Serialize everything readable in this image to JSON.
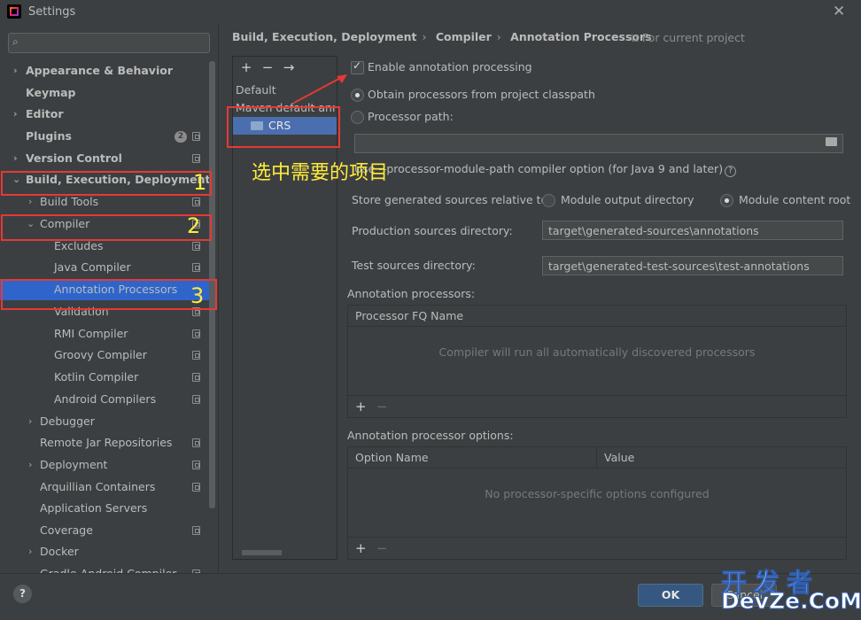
{
  "window": {
    "title": "Settings"
  },
  "search": {
    "placeholder": ""
  },
  "sidebar": {
    "items": [
      {
        "label": "Appearance & Behavior"
      },
      {
        "label": "Keymap"
      },
      {
        "label": "Editor"
      },
      {
        "label": "Plugins",
        "badge": "2"
      },
      {
        "label": "Version Control"
      },
      {
        "label": "Build, Execution, Deployment"
      },
      {
        "label": "Build Tools"
      },
      {
        "label": "Compiler"
      },
      {
        "label": "Excludes"
      },
      {
        "label": "Java Compiler"
      },
      {
        "label": "Annotation Processors"
      },
      {
        "label": "Validation"
      },
      {
        "label": "RMI Compiler"
      },
      {
        "label": "Groovy Compiler"
      },
      {
        "label": "Kotlin Compiler"
      },
      {
        "label": "Android Compilers"
      },
      {
        "label": "Debugger"
      },
      {
        "label": "Remote Jar Repositories"
      },
      {
        "label": "Deployment"
      },
      {
        "label": "Arquillian Containers"
      },
      {
        "label": "Application Servers"
      },
      {
        "label": "Coverage"
      },
      {
        "label": "Docker"
      },
      {
        "label": "Gradle-Android Compiler"
      }
    ]
  },
  "breadcrumb": {
    "items": [
      "Build, Execution, Deployment",
      "Compiler",
      "Annotation Processors"
    ],
    "scope": "For current project"
  },
  "profiles": {
    "toolbar": [
      "+",
      "−",
      "→"
    ],
    "items": [
      "Default",
      "Maven default anno",
      "CRS"
    ]
  },
  "options": {
    "enable_processing": "Enable annotation processing",
    "obtain_from_classpath": "Obtain processors from project classpath",
    "processor_path": "Processor path:",
    "module_path_option": "Use --processor-module-path compiler option (for Java 9 and later)",
    "store_generated_label": "Store generated sources relative to:",
    "module_output_dir": "Module output directory",
    "module_content_root": "Module content root",
    "production_dir_label": "Production sources directory:",
    "production_dir_value": "target\\generated-sources\\annotations",
    "test_dir_label": "Test sources directory:",
    "test_dir_value": "target\\generated-test-sources\\test-annotations"
  },
  "processors_table": {
    "title": "Annotation processors:",
    "column": "Processor FQ Name",
    "empty": "Compiler will run all automatically discovered processors"
  },
  "options_table": {
    "title": "Annotation processor options:",
    "columns": [
      "Option Name",
      "Value"
    ],
    "empty": "No processor-specific options configured"
  },
  "buttons": {
    "help": "?",
    "ok": "OK",
    "cancel": "Cancel"
  },
  "annotations": {
    "n1": "1",
    "n2": "2",
    "n3": "3",
    "note": "选中需要的项目"
  },
  "watermark": {
    "line1": "开发者",
    "line2": "DevZe.CoM"
  }
}
